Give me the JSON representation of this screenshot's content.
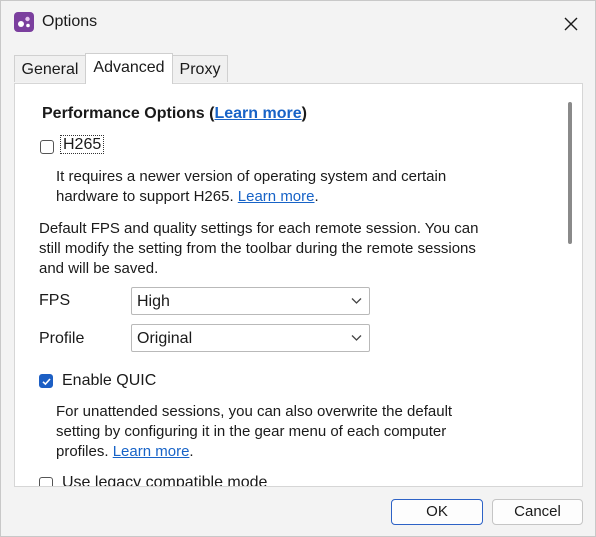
{
  "window": {
    "title": "Options",
    "app_icon": "app-logo-icon",
    "close_icon": "close-icon"
  },
  "tabs": [
    {
      "label": "General",
      "active": false
    },
    {
      "label": "Advanced",
      "active": true
    },
    {
      "label": "Proxy",
      "active": false
    }
  ],
  "performance": {
    "title_prefix": "Performance Options (",
    "title_link": "Learn more",
    "title_suffix": ")",
    "h265": {
      "label": "H265",
      "checked": false,
      "desc_line1": "It requires a newer version of operating system and certain",
      "desc_line2": "hardware to support H265.",
      "learn_more": "Learn more",
      "period": "."
    },
    "fps_intro": [
      "Default FPS and quality settings for each remote session. You can",
      "still modify the setting from the toolbar during the remote sessions",
      "and will be saved."
    ],
    "fps": {
      "label": "FPS",
      "value": "High"
    },
    "profile": {
      "label": "Profile",
      "value": "Original"
    },
    "quic": {
      "label": "Enable QUIC",
      "checked": true,
      "desc_line1": "For unattended sessions, you can also overwrite the default",
      "desc_line2": "setting by configuring it in the gear menu of each computer",
      "desc_line3": "profiles.",
      "learn_more": "Learn more",
      "period": "."
    },
    "legacy": {
      "label": "Use legacy compatible mode",
      "checked": false
    }
  },
  "buttons": {
    "ok": "OK",
    "cancel": "Cancel"
  },
  "colors": {
    "accent": "#1d5fc4",
    "link": "#1763c7",
    "logo": "#7b3f9e"
  }
}
